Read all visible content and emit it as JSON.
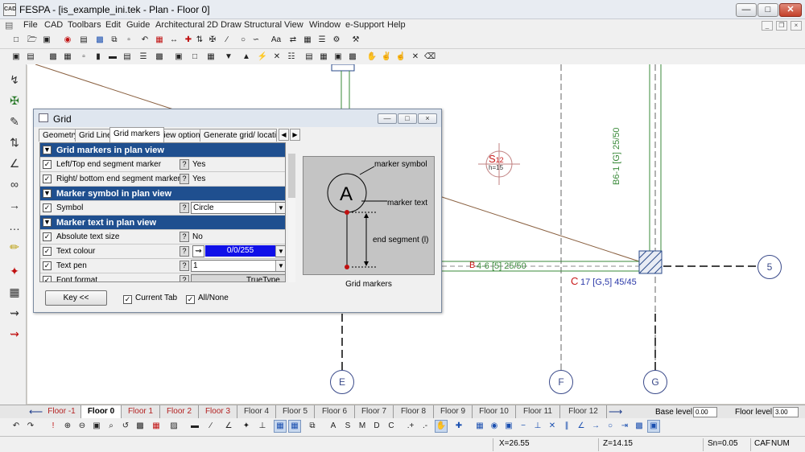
{
  "window": {
    "title": "FESPA - [is_example_ini.tek - Plan - Floor 0]",
    "app_icon_text": "CAD"
  },
  "menu": {
    "items": [
      "File",
      "CAD",
      "Toolbars",
      "Edit",
      "Guide",
      "Architectural",
      "2D Draw",
      "Structural",
      "View",
      "Window",
      "e-Support",
      "Help"
    ]
  },
  "toolbar1": {
    "font_btn": "Aa"
  },
  "canvas": {
    "grid_labels": {
      "e": "E",
      "f": "F",
      "g": "G",
      "five": "5"
    },
    "column_label": {
      "letter": "S",
      "num": "12",
      "h": "h=15"
    },
    "beam_red": "C",
    "beam_blue": "17 [G,5]  45/45",
    "beam_b_red": "B",
    "beam_green": "4-6 [5]  25/50",
    "beam_vert_green": "B6-1 [G]  25/50"
  },
  "dialog": {
    "title": "Grid",
    "tabs": [
      "Geometry",
      "Grid Line",
      "Grid markers",
      "View options",
      "Generate grid/ location o"
    ],
    "active_tab": "Grid markers",
    "rows": [
      {
        "type": "header",
        "label": "Grid markers in plan view"
      },
      {
        "type": "prop",
        "label": "Left/Top end segment marker",
        "value": "Yes"
      },
      {
        "type": "prop",
        "label": "Right/ bottom end segment marker",
        "value": "Yes"
      },
      {
        "type": "header",
        "label": "Marker symbol in plan view"
      },
      {
        "type": "combo",
        "label": "Symbol",
        "value": "Circle"
      },
      {
        "type": "header",
        "label": "Marker text in plan view"
      },
      {
        "type": "prop",
        "label": "Absolute text size",
        "value": "No"
      },
      {
        "type": "color",
        "label": "Text colour",
        "value": "0/0/255"
      },
      {
        "type": "combo",
        "label": "Text pen",
        "value": "1"
      },
      {
        "type": "font",
        "label": "Font format",
        "value": "TrueType"
      }
    ],
    "help_glyph": "?",
    "preview": {
      "marker_letter": "A",
      "marker_symbol": "marker symbol",
      "marker_text": "marker text",
      "end_segment": "end segment (l)",
      "caption": "Grid markers"
    },
    "key_button": "Key <<",
    "current_tab_check": "Current Tab",
    "all_none_check": "All/None",
    "colors": {
      "header_bg": "#1f4f8f",
      "text_colour": "#1010e8"
    }
  },
  "floors": {
    "tabs": [
      "Floor -1",
      "Floor 0",
      "Floor 1",
      "Floor 2",
      "Floor 3",
      "Floor 4",
      "Floor 5",
      "Floor 6",
      "Floor 7",
      "Floor 8",
      "Floor 9",
      "Floor 10",
      "Floor 11",
      "Floor 12"
    ],
    "active": "Floor 0",
    "base_level_label": "Base level:",
    "base_level_value": "0.00",
    "floor_level_label": "Floor level:",
    "floor_level_value": "3.00"
  },
  "status": {
    "x": "X=26.55",
    "z": "Z=14.15",
    "sn": "Sn=0.05",
    "caf": "CAF",
    "num": "NUM"
  }
}
